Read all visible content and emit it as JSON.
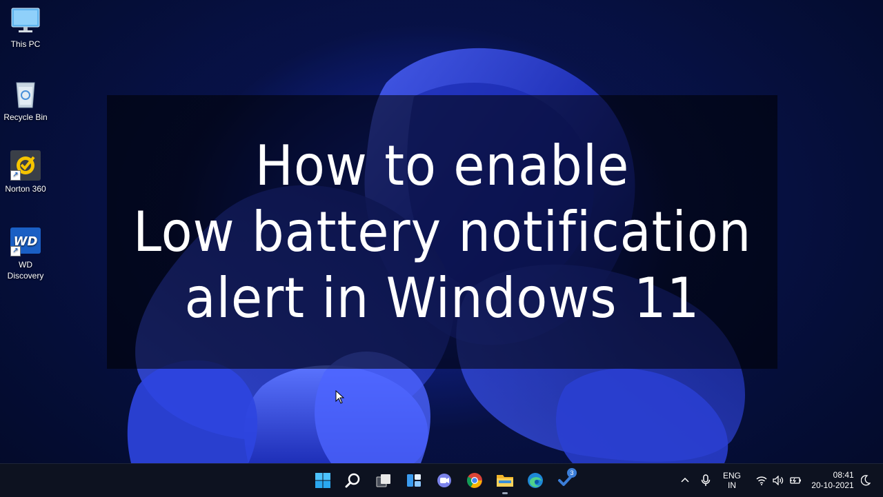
{
  "desktop": {
    "icons": [
      {
        "label": "This PC",
        "icon": "monitor-icon"
      },
      {
        "label": "Recycle Bin",
        "icon": "recycle-bin-icon"
      },
      {
        "label": "Norton 360",
        "icon": "norton-icon"
      },
      {
        "label": "WD\nDiscovery",
        "icon": "wd-discovery-icon"
      }
    ]
  },
  "overlay": {
    "lines": [
      "How to enable",
      "Low battery notification",
      "alert in Windows 11"
    ]
  },
  "taskbar": {
    "apps": [
      {
        "name": "start",
        "icon": "windows-start-icon"
      },
      {
        "name": "search",
        "icon": "search-icon"
      },
      {
        "name": "task-view",
        "icon": "task-view-icon"
      },
      {
        "name": "widgets",
        "icon": "widgets-icon"
      },
      {
        "name": "teams-chat",
        "icon": "teams-chat-icon"
      },
      {
        "name": "chrome",
        "icon": "chrome-icon"
      },
      {
        "name": "file-explorer",
        "icon": "folder-icon"
      },
      {
        "name": "edge",
        "icon": "edge-icon"
      },
      {
        "name": "todo",
        "icon": "todo-icon",
        "badge": "3"
      }
    ],
    "tray": {
      "language_line1": "ENG",
      "language_line2": "IN",
      "time": "08:41",
      "date": "20-10-2021"
    }
  },
  "colors": {
    "accent": "#3b7dd8",
    "taskbar": "#0d1220",
    "wallpaper_bloom": "#2a3de0"
  }
}
